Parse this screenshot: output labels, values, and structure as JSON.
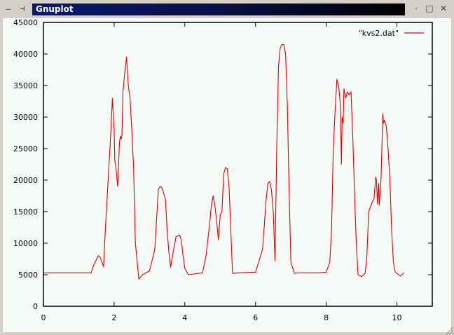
{
  "window": {
    "title": "Gnuplot",
    "left_controls": [
      "—",
      "⊣"
    ],
    "right_controls": {
      "minimize": "·",
      "maximize": "□",
      "close": "✕"
    }
  },
  "colors": {
    "series": "#e00000",
    "plot_background": "#f6faf6",
    "title_gradient_start": "#0a1a6e",
    "title_gradient_end": "#000000"
  },
  "chart_data": {
    "type": "line",
    "title": "",
    "xlabel": "",
    "ylabel": "",
    "xlim": [
      0,
      11
    ],
    "ylim": [
      0,
      45000
    ],
    "x_ticks": [
      "0",
      "2",
      "4",
      "6",
      "8",
      "10"
    ],
    "y_ticks": [
      "0",
      "5000",
      "10000",
      "15000",
      "20000",
      "25000",
      "30000",
      "35000",
      "40000",
      "45000"
    ],
    "x_tick_values": [
      0,
      2,
      4,
      6,
      8,
      10
    ],
    "y_tick_values": [
      0,
      5000,
      10000,
      15000,
      20000,
      25000,
      30000,
      35000,
      40000,
      45000
    ],
    "legend": {
      "placement": "top-right"
    },
    "series": [
      {
        "name": "\"kvs2.dat\"",
        "x": [
          0,
          0.5,
          1.0,
          1.35,
          1.42,
          1.55,
          1.6,
          1.7,
          1.75,
          1.8,
          1.9,
          1.95,
          2.0,
          2.02,
          2.05,
          2.1,
          2.15,
          2.18,
          2.2,
          2.22,
          2.25,
          2.3,
          2.35,
          2.38,
          2.4,
          2.45,
          2.5,
          2.55,
          2.6,
          2.7,
          2.8,
          3.0,
          3.15,
          3.25,
          3.3,
          3.35,
          3.45,
          3.5,
          3.55,
          3.6,
          3.65,
          3.75,
          3.85,
          3.9,
          3.95,
          4.0,
          4.1,
          4.5,
          4.6,
          4.7,
          4.75,
          4.8,
          4.85,
          4.9,
          4.95,
          5.0,
          5.05,
          5.1,
          5.15,
          5.2,
          5.25,
          5.3,
          5.35,
          5.5,
          6.0,
          6.2,
          6.3,
          6.35,
          6.4,
          6.45,
          6.5,
          6.55,
          6.6,
          6.65,
          6.7,
          6.75,
          6.8,
          6.85,
          6.9,
          6.95,
          7.0,
          7.1,
          7.2,
          7.5,
          7.8,
          8.0,
          8.1,
          8.15,
          8.2,
          8.25,
          8.3,
          8.35,
          8.4,
          8.43,
          8.45,
          8.48,
          8.5,
          8.55,
          8.6,
          8.65,
          8.7,
          8.75,
          8.8,
          8.85,
          8.9,
          9.0,
          9.1,
          9.15,
          9.2,
          9.3,
          9.35,
          9.4,
          9.42,
          9.45,
          9.48,
          9.5,
          9.55,
          9.6,
          9.62,
          9.65,
          9.7,
          9.75,
          9.8,
          9.85,
          9.9,
          9.95,
          10.0,
          10.1,
          10.2
        ],
        "y": [
          5300,
          5300,
          5300,
          5300,
          6500,
          8000,
          7800,
          6300,
          12000,
          17000,
          27000,
          33000,
          28000,
          23000,
          22000,
          19000,
          26000,
          27000,
          26500,
          27000,
          34000,
          37000,
          39500,
          37000,
          35000,
          33000,
          28000,
          22000,
          10000,
          4300,
          5000,
          5600,
          9000,
          18500,
          19000,
          18800,
          17000,
          12000,
          8500,
          6200,
          8000,
          11000,
          11300,
          10500,
          8000,
          6000,
          5000,
          5300,
          8000,
          13000,
          16000,
          17500,
          16000,
          13500,
          10500,
          14500,
          15000,
          21000,
          22000,
          21800,
          19000,
          12000,
          5200,
          5300,
          5400,
          9000,
          17000,
          19500,
          19800,
          18500,
          15000,
          7200,
          25000,
          38000,
          41000,
          41500,
          41500,
          40000,
          32000,
          18000,
          7000,
          5200,
          5300,
          5300,
          5300,
          5400,
          7000,
          12000,
          25000,
          31000,
          36000,
          35000,
          32000,
          22500,
          30000,
          29000,
          34500,
          33000,
          34000,
          33500,
          34000,
          27000,
          18000,
          10000,
          5000,
          4700,
          5200,
          8000,
          15000,
          16500,
          17000,
          20500,
          20000,
          16200,
          19500,
          16000,
          20000,
          30500,
          29000,
          29500,
          28500,
          25000,
          20000,
          12000,
          7000,
          5500,
          5200,
          4800,
          5300
        ]
      }
    ]
  }
}
